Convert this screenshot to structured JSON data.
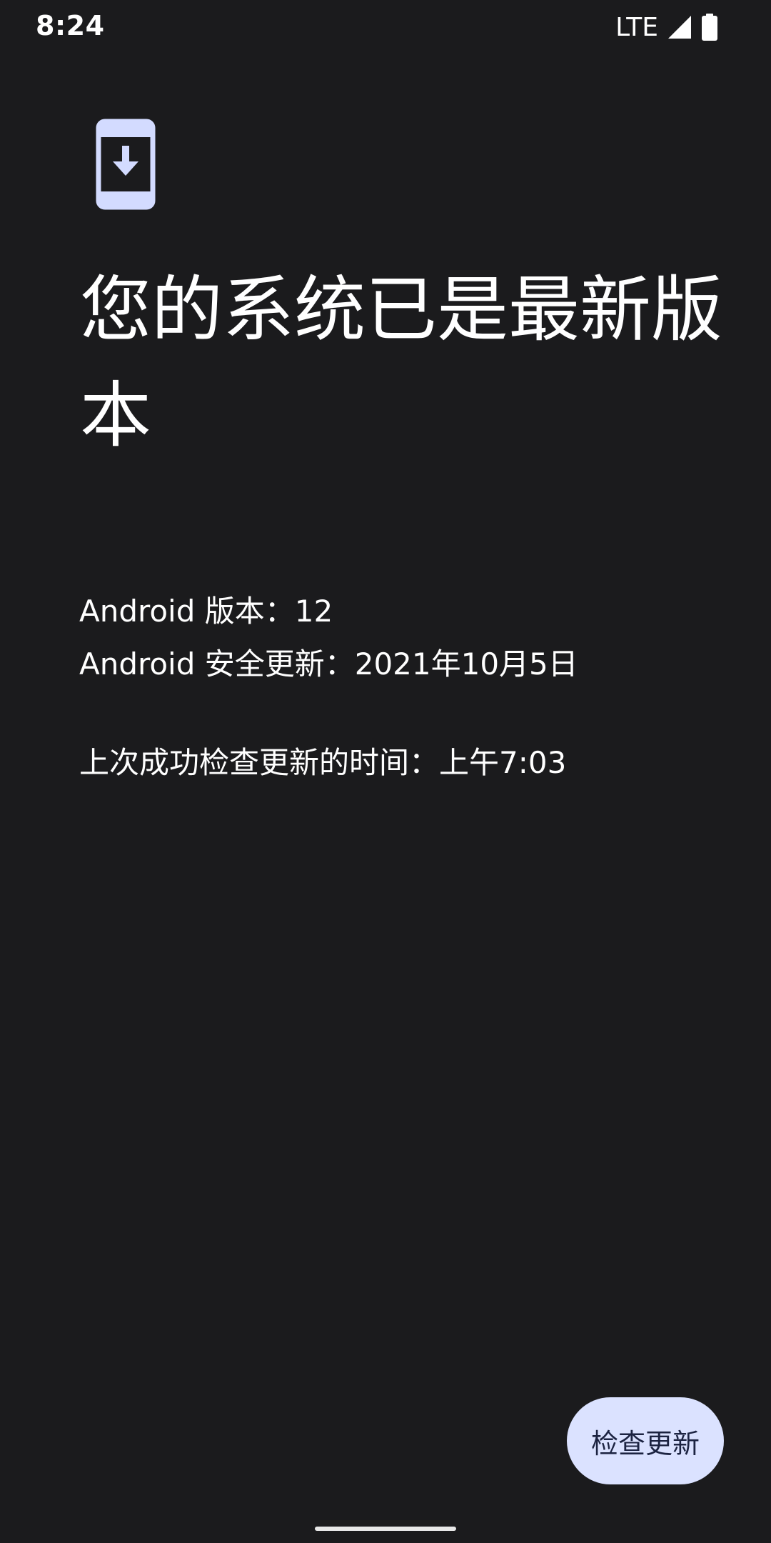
{
  "status_bar": {
    "time": "8:24",
    "network": "LTE",
    "signal_icon": "cell-signal-icon",
    "battery_icon": "battery-full-icon"
  },
  "header": {
    "icon": "system-update-icon",
    "icon_color": "#d3dbff",
    "title": "您的系统已是最新版本"
  },
  "info": {
    "android_version": "Android 版本：12",
    "security_update": "Android 安全更新：2021年10月5日",
    "last_check": "上次成功检查更新的时间：上午7:03"
  },
  "actions": {
    "check_button_label": "检查更新",
    "check_button_color": "#dbe2ff"
  },
  "colors": {
    "background": "#1b1b1d",
    "text": "#ffffff"
  }
}
